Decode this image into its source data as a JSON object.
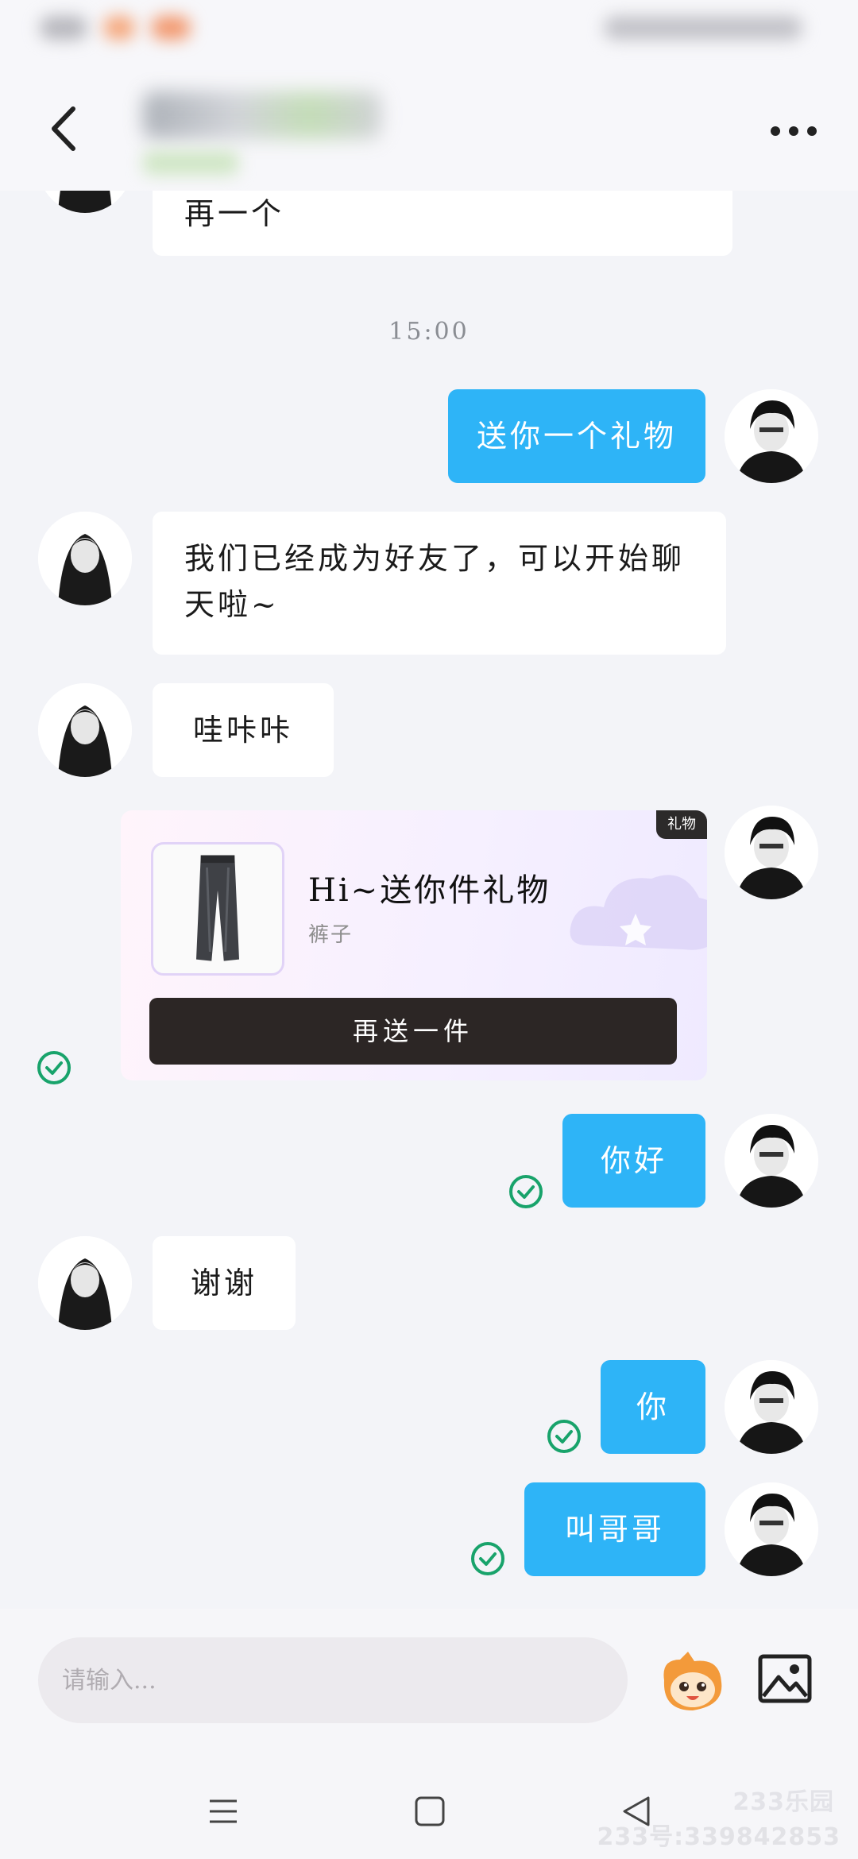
{
  "header": {
    "back_icon": "chevron-left-icon",
    "more_icon": "more-horizontal-icon"
  },
  "messages": {
    "prev_tail": "再一个",
    "timestamp": "15:00",
    "m1": "送你一个礼物",
    "m2": "我们已经成为好友了，可以开始聊天啦~",
    "m3": "哇咔咔",
    "m5": "你好",
    "m6": "谢谢",
    "m7": "你",
    "m8": "叫哥哥"
  },
  "gift_card": {
    "tag": "礼物",
    "title": "Hi~送你件礼物",
    "subtitle": "裤子",
    "button": "再送一件"
  },
  "input": {
    "placeholder": "请输入..."
  },
  "nav": {
    "menu_icon": "menu-icon",
    "home_icon": "square-icon",
    "back_icon": "triangle-back-icon"
  },
  "watermark": {
    "logo": "233乐园",
    "id": "233号:339842853"
  },
  "colors": {
    "background": "#f3f4f8",
    "outgoing_bubble": "#2eb4f7",
    "incoming_bubble": "#ffffff",
    "check": "#18a36b",
    "gift_button": "#2c2625"
  }
}
